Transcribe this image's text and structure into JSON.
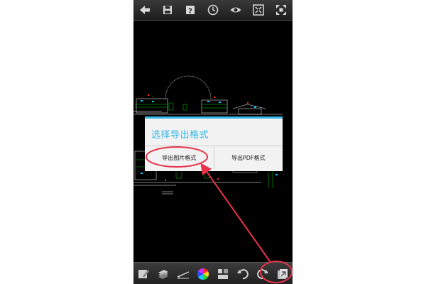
{
  "top_toolbar": {
    "icons": [
      "back-arrow-icon",
      "save-icon",
      "help-icon",
      "clock-icon",
      "eye-icon",
      "fit-screen-icon",
      "fullscreen-icon"
    ]
  },
  "dialog": {
    "title": "选择导出格式",
    "buttons": [
      "导出图片格式",
      "导出PDF格式"
    ]
  },
  "bottom_toolbar": {
    "icons": [
      "edit-icon",
      "layers-icon",
      "measure-icon",
      "color-wheel-icon",
      "blocks-icon",
      "undo-icon",
      "redo-icon",
      "export-icon"
    ]
  },
  "colors": {
    "dialog_accent": "#33b5e5",
    "annotation": "#e8334a",
    "cad_green": "#00d000",
    "cad_white": "#ffffff",
    "cad_cyan": "#00c8ff"
  }
}
